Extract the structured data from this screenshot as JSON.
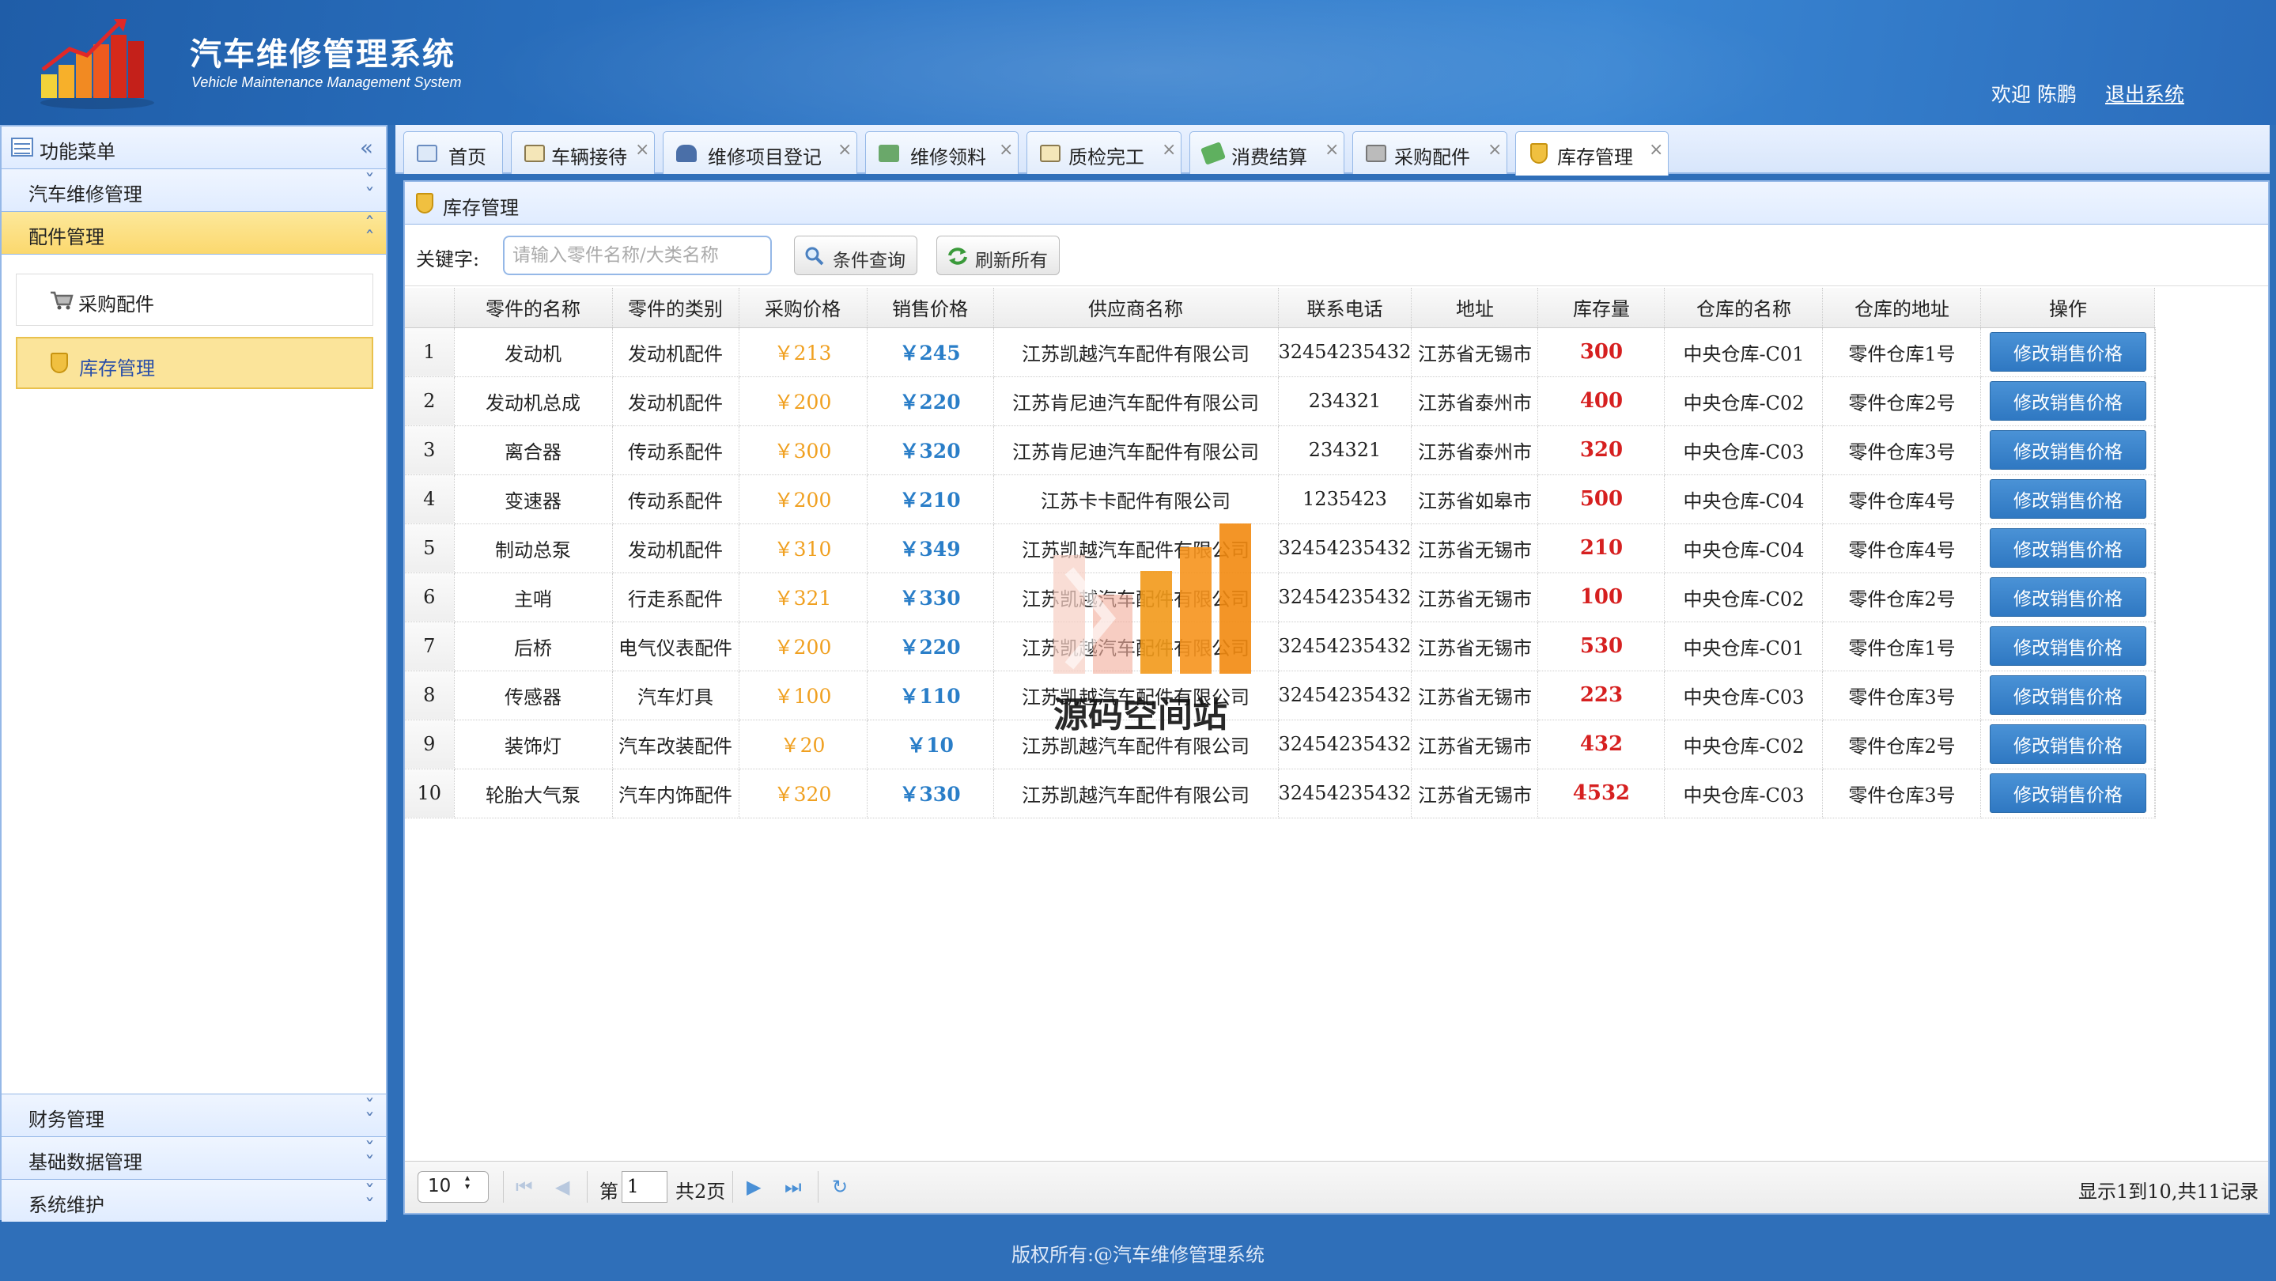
{
  "header": {
    "title": "汽车维修管理系统",
    "subtitle": "Vehicle Maintenance Management System",
    "welcome": "欢迎 陈鹏",
    "logout": "退出系统"
  },
  "sidebar": {
    "title": "功能菜单",
    "sections": [
      {
        "label": "汽车维修管理"
      },
      {
        "label": "配件管理"
      },
      {
        "label": "财务管理"
      },
      {
        "label": "基础数据管理"
      },
      {
        "label": "系统维护"
      }
    ],
    "items": [
      {
        "label": "采购配件"
      },
      {
        "label": "库存管理"
      }
    ]
  },
  "tabs": [
    {
      "label": "首页"
    },
    {
      "label": "车辆接待"
    },
    {
      "label": "维修项目登记"
    },
    {
      "label": "维修领料"
    },
    {
      "label": "质检完工"
    },
    {
      "label": "消费结算"
    },
    {
      "label": "采购配件"
    },
    {
      "label": "库存管理"
    }
  ],
  "panel": {
    "title": "库存管理",
    "keyword_label": "关键字:",
    "search_placeholder": "请输入零件名称/大类名称",
    "search_button": "条件查询",
    "refresh_button": "刷新所有"
  },
  "grid": {
    "headers": [
      "零件的名称",
      "零件的类别",
      "采购价格",
      "销售价格",
      "供应商名称",
      "联系电话",
      "地址",
      "库存量",
      "仓库的名称",
      "仓库的地址",
      "操作"
    ],
    "op_label": "修改销售价格",
    "rows": [
      {
        "n": "1",
        "name": "发动机",
        "cat": "发动机配件",
        "buy": "￥213",
        "sell": "￥245",
        "supplier": "江苏凯越汽车配件有限公司",
        "phone": "32454235432",
        "addr": "江苏省无锡市",
        "stock": "300",
        "wh": "中央仓库-C01",
        "wh_addr": "零件仓库1号"
      },
      {
        "n": "2",
        "name": "发动机总成",
        "cat": "发动机配件",
        "buy": "￥200",
        "sell": "￥220",
        "supplier": "江苏肯尼迪汽车配件有限公司",
        "phone": "234321",
        "addr": "江苏省泰州市",
        "stock": "400",
        "wh": "中央仓库-C02",
        "wh_addr": "零件仓库2号"
      },
      {
        "n": "3",
        "name": "离合器",
        "cat": "传动系配件",
        "buy": "￥300",
        "sell": "￥320",
        "supplier": "江苏肯尼迪汽车配件有限公司",
        "phone": "234321",
        "addr": "江苏省泰州市",
        "stock": "320",
        "wh": "中央仓库-C03",
        "wh_addr": "零件仓库3号"
      },
      {
        "n": "4",
        "name": "变速器",
        "cat": "传动系配件",
        "buy": "￥200",
        "sell": "￥210",
        "supplier": "江苏卡卡配件有限公司",
        "phone": "1235423",
        "addr": "江苏省如皋市",
        "stock": "500",
        "wh": "中央仓库-C04",
        "wh_addr": "零件仓库4号"
      },
      {
        "n": "5",
        "name": "制动总泵",
        "cat": "发动机配件",
        "buy": "￥310",
        "sell": "￥349",
        "supplier": "江苏凯越汽车配件有限公司",
        "phone": "32454235432",
        "addr": "江苏省无锡市",
        "stock": "210",
        "wh": "中央仓库-C04",
        "wh_addr": "零件仓库4号"
      },
      {
        "n": "6",
        "name": "主哨",
        "cat": "行走系配件",
        "buy": "￥321",
        "sell": "￥330",
        "supplier": "江苏凯越汽车配件有限公司",
        "phone": "32454235432",
        "addr": "江苏省无锡市",
        "stock": "100",
        "wh": "中央仓库-C02",
        "wh_addr": "零件仓库2号"
      },
      {
        "n": "7",
        "name": "后桥",
        "cat": "电气仪表配件",
        "buy": "￥200",
        "sell": "￥220",
        "supplier": "江苏凯越汽车配件有限公司",
        "phone": "32454235432",
        "addr": "江苏省无锡市",
        "stock": "530",
        "wh": "中央仓库-C01",
        "wh_addr": "零件仓库1号"
      },
      {
        "n": "8",
        "name": "传感器",
        "cat": "汽车灯具",
        "buy": "￥100",
        "sell": "￥110",
        "supplier": "江苏凯越汽车配件有限公司",
        "phone": "32454235432",
        "addr": "江苏省无锡市",
        "stock": "223",
        "wh": "中央仓库-C03",
        "wh_addr": "零件仓库3号"
      },
      {
        "n": "9",
        "name": "装饰灯",
        "cat": "汽车改装配件",
        "buy": "￥20",
        "sell": "￥10",
        "supplier": "江苏凯越汽车配件有限公司",
        "phone": "32454235432",
        "addr": "江苏省无锡市",
        "stock": "432",
        "wh": "中央仓库-C02",
        "wh_addr": "零件仓库2号"
      },
      {
        "n": "10",
        "name": "轮胎大气泵",
        "cat": "汽车内饰配件",
        "buy": "￥320",
        "sell": "￥330",
        "supplier": "江苏凯越汽车配件有限公司",
        "phone": "32454235432",
        "addr": "江苏省无锡市",
        "stock": "4532",
        "wh": "中央仓库-C03",
        "wh_addr": "零件仓库3号"
      }
    ]
  },
  "pager": {
    "page_size": "10",
    "page_prefix": "第",
    "current_page": "1",
    "total_pages": "共2页",
    "info": "显示1到10,共11记录"
  },
  "watermark": "源码空间站",
  "footer": "版权所有:@汽车维修管理系统"
}
